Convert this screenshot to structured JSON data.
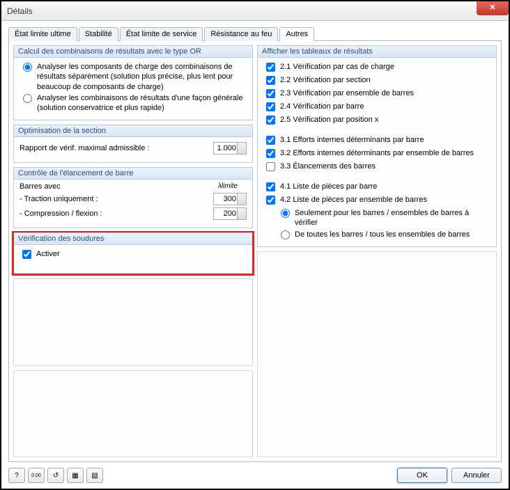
{
  "window": {
    "title": "Détails"
  },
  "tabs": [
    {
      "label": "État limite ultime"
    },
    {
      "label": "Stabilité"
    },
    {
      "label": "État limite de service"
    },
    {
      "label": "Résistance au feu"
    },
    {
      "label": "Autres"
    }
  ],
  "groups": {
    "calc": {
      "title": "Calcul des combinaisons de résultats avec le type OR",
      "opt1": "Analyser les composants de charge des combinaisons de résultats séparément (solution plus précise, plus lent pour beaucoup de composants de charge)",
      "opt2": "Analyser les combinaisons de résultats d'une façon générale (solution conservatrice et plus rapide)"
    },
    "optim": {
      "title": "Optimisation de la section",
      "ratio_label": "Rapport de vérif. maximal admissible :",
      "ratio_value": "1.000"
    },
    "slender": {
      "title": "Contrôle de l'élancement de barre",
      "bars_label": "Barres avec",
      "lambda_label": "λlimite",
      "traction_label": "- Traction uniquement :",
      "traction_value": "300",
      "compression_label": "- Compression / flexion :",
      "compression_value": "200"
    },
    "weld": {
      "title": "Vérification des soudures",
      "activate": "Activer"
    },
    "tables": {
      "title": "Afficher les tableaux de résultats",
      "i21": "2.1 Vérification par cas de charge",
      "i22": "2.2 Vérification par section",
      "i23": "2.3 Vérification par ensemble de barres",
      "i24": "2.4 Vérification par barre",
      "i25": "2.5 Vérification par position x",
      "i31": "3.1 Efforts internes déterminants par barre",
      "i32": "3.2 Efforts internes déterminants par ensemble de barres",
      "i33": "3.3 Élancements des barres",
      "i41": "4.1 Liste de pièces par barre",
      "i42": "4.2 Liste de pièces par ensemble de barres",
      "i42a": "Seulement pour les barres / ensembles de barres à vérifier",
      "i42b": "De toutes les barres / tous les ensembles de barres"
    }
  },
  "buttons": {
    "ok": "OK",
    "cancel": "Annuler"
  },
  "icons": {
    "b1": "?",
    "b2": "0.00",
    "b3": "↺",
    "b4": "▦",
    "b5": "▧"
  }
}
